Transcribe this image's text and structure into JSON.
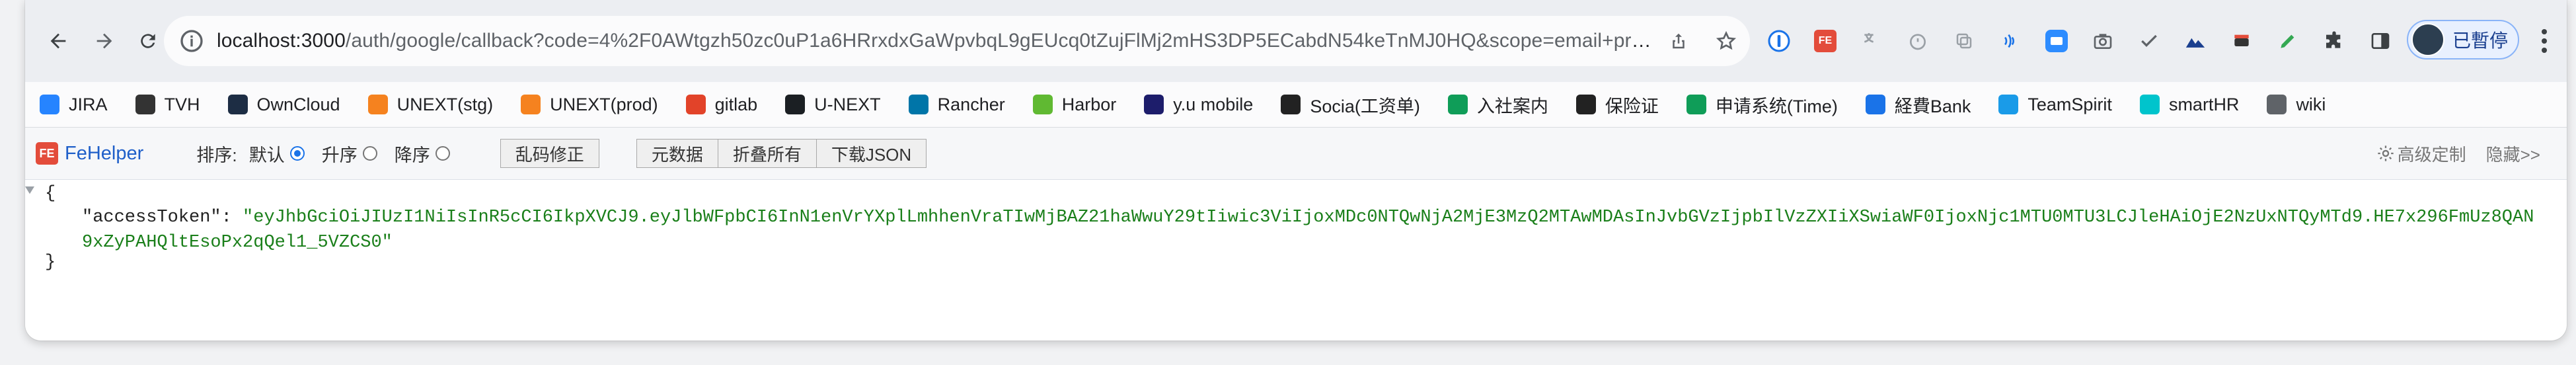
{
  "browser": {
    "url_host": "localhost:3000",
    "url_rest": "/auth/google/callback?code=4%2F0AWtgzh50zc0uP1a6HRrxdxGaWpvbqL9gEUcq0tZujFlMj2mHS3DP5ECabdN54keTnMJ0HQ&scope=email+profile+...",
    "profile_label": "已暫停"
  },
  "bookmarks": [
    {
      "label": "JIRA",
      "icon": "jira-icon",
      "color": "#2684ff"
    },
    {
      "label": "TVH",
      "icon": "person-icon",
      "color": "#333333"
    },
    {
      "label": "OwnCloud",
      "icon": "cloud-icon",
      "color": "#1d2d44"
    },
    {
      "label": "UNEXT(stg)",
      "icon": "unext-icon",
      "color": "#f5821f"
    },
    {
      "label": "UNEXT(prod)",
      "icon": "unext-icon",
      "color": "#f5821f"
    },
    {
      "label": "gitlab",
      "icon": "gitlab-icon",
      "color": "#e24329"
    },
    {
      "label": "U-NEXT",
      "icon": "github-icon",
      "color": "#1b1f23"
    },
    {
      "label": "Rancher",
      "icon": "rancher-icon",
      "color": "#0075a8"
    },
    {
      "label": "Harbor",
      "icon": "harbor-icon",
      "color": "#60b932"
    },
    {
      "label": "y.u mobile",
      "icon": "yu-icon",
      "color": "#1d1d6b"
    },
    {
      "label": "Socia(工资单)",
      "icon": "globe-icon",
      "color": "#222222"
    },
    {
      "label": "入社案内",
      "icon": "plus-icon",
      "color": "#0f9d58"
    },
    {
      "label": "保险证",
      "icon": "globe-icon",
      "color": "#222222"
    },
    {
      "label": "申请系统(Time)",
      "icon": "time-icon",
      "color": "#0f9d58"
    },
    {
      "label": "経費Bank",
      "icon": "bank-icon",
      "color": "#1a73e8"
    },
    {
      "label": "TeamSpirit",
      "icon": "teamspirit-icon",
      "color": "#1a9be8"
    },
    {
      "label": "smartHR",
      "icon": "smarthr-icon",
      "color": "#00c4cc"
    },
    {
      "label": "wiki",
      "icon": "folder-icon",
      "color": "#5f6368"
    }
  ],
  "fehelper": {
    "title": "FeHelper",
    "sort_label": "排序:",
    "sort_default": "默认",
    "sort_asc": "升序",
    "sort_desc": "降序",
    "fix_button": "乱码修正",
    "raw_button": "元数据",
    "collapse_button": "折叠所有",
    "download_button": "下载JSON",
    "advanced_label": "高级定制",
    "hide_label": "隐藏>>"
  },
  "json_view": {
    "open_brace": "{",
    "close_brace": "}",
    "key": "\"accessToken\": ",
    "value": "\"eyJhbGciOiJIUzI1NiIsInR5cCI6IkpXVCJ9.eyJlbWFpbCI6InN1enVrYXplLmhhenVraTIwMjBAZ21haWwuY29tIiwic3ViIjoxMDc0NTQwNjA2MjE3MzQ2MTAwMDAsInJvbGVzIjpbIlVzZXIiXSwiaWF0IjoxNjc1MTU0MTU3LCJleHAiOjE2NzUxNTQyMTd9.HE7x296FmUz8QAN9xZyPAHQltEsoPx2qQel1_5VZCS0\""
  }
}
